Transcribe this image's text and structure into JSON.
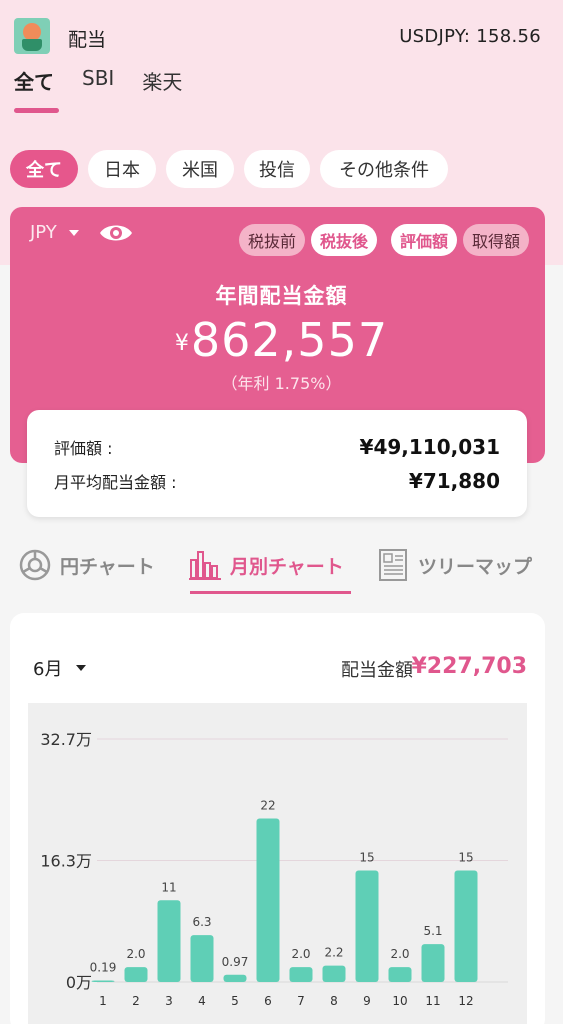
{
  "header": {
    "title": "配当",
    "rate": "USDJPY: 158.56"
  },
  "account_tabs": [
    {
      "label": "全て",
      "active": true
    },
    {
      "label": "SBI",
      "active": false
    },
    {
      "label": "楽天",
      "active": false
    }
  ],
  "filters": [
    {
      "label": "全て",
      "active": true
    },
    {
      "label": "日本",
      "active": false
    },
    {
      "label": "米国",
      "active": false
    },
    {
      "label": "投信",
      "active": false
    },
    {
      "label": "その他条件",
      "active": false
    }
  ],
  "summary": {
    "currency": "JPY",
    "tax_toggle": {
      "before": "税抜前",
      "after": "税抜後",
      "selected": "税抜後"
    },
    "value_toggle": {
      "market": "評価額",
      "cost": "取得額",
      "selected": "評価額"
    },
    "heading": "年間配当金額",
    "yen": "¥",
    "amount": "862,557",
    "yield": "（年利 1.75%）",
    "market_value_label": "評価額 :",
    "market_value": "¥49,110,031",
    "monthly_avg_label": "月平均配当金額 :",
    "monthly_avg": "¥71,880"
  },
  "chart_tabs": [
    {
      "label": "円チャート",
      "icon": "pie-chart-icon",
      "active": false
    },
    {
      "label": "月別チャート",
      "icon": "bar-chart-icon",
      "active": true
    },
    {
      "label": "ツリーマップ",
      "icon": "treemap-icon",
      "active": false
    }
  ],
  "chart_header": {
    "month": "6月",
    "label": "配当金額",
    "amount": "¥227,703"
  },
  "colors": {
    "accent": "#e0578d",
    "bar": "#5fcfb6"
  },
  "chart_data": {
    "type": "bar",
    "categories": [
      "1",
      "2",
      "3",
      "4",
      "5",
      "6",
      "7",
      "8",
      "9",
      "10",
      "11",
      "12"
    ],
    "values": [
      0.19,
      2.0,
      11,
      6.3,
      0.97,
      22,
      2.0,
      2.2,
      15,
      2.0,
      5.1,
      15
    ],
    "value_labels": [
      "0.19",
      "2.0",
      "11",
      "6.3",
      "0.97",
      "22",
      "2.0",
      "2.2",
      "15",
      "2.0",
      "5.1",
      "15"
    ],
    "yticks": [
      "0万",
      "16.3万",
      "32.7万"
    ],
    "ytick_values": [
      0,
      16.35,
      32.7
    ],
    "ylim": [
      0,
      32.7
    ],
    "grid": true
  }
}
